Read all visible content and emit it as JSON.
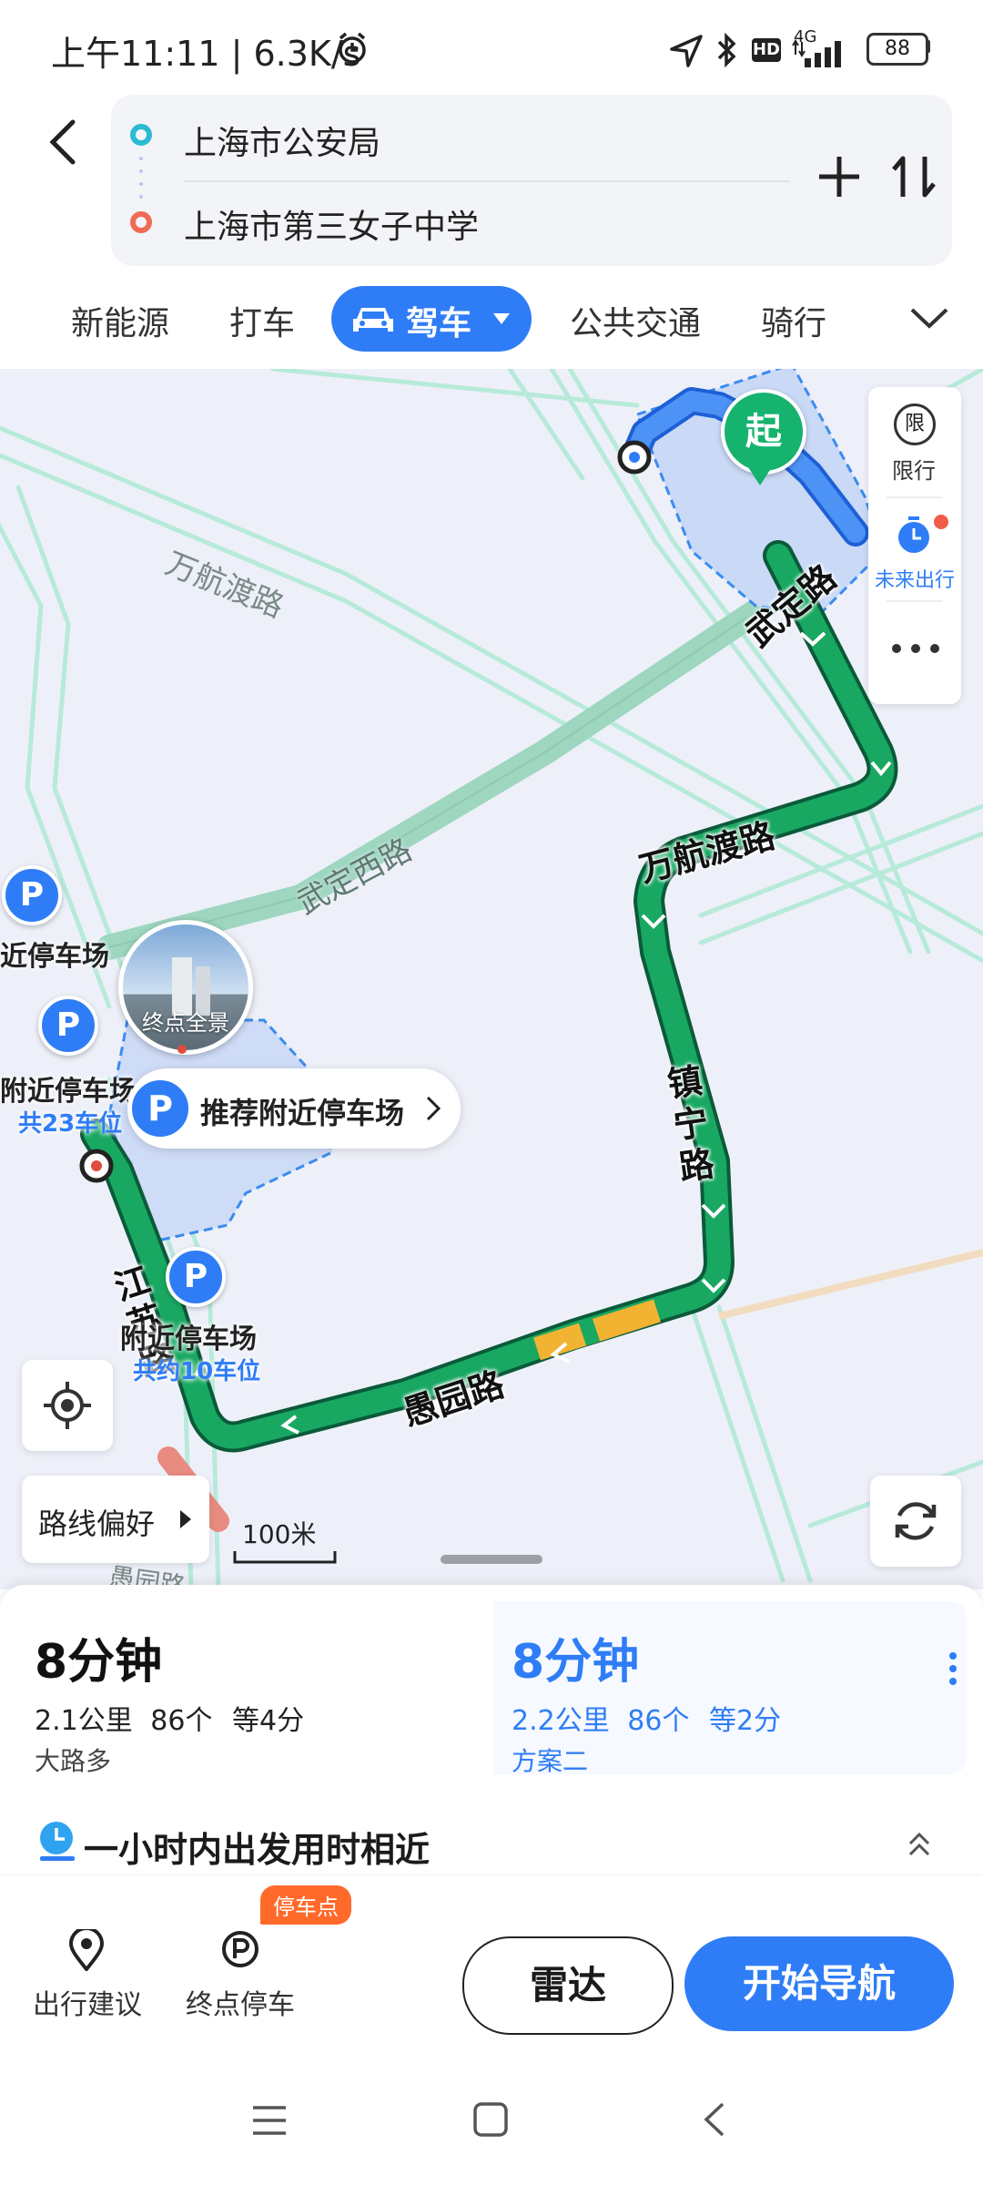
{
  "status_bar": {
    "left_text": "上午11:11 | 6.3K/s",
    "network": "4G",
    "hd": "HD",
    "battery": "88"
  },
  "route": {
    "origin": "上海市公安局",
    "destination": "上海市第三女子中学"
  },
  "modes": {
    "new_energy": "新能源",
    "taxi": "打车",
    "drive": "驾车",
    "transit": "公共交通",
    "bike": "骑行"
  },
  "map": {
    "start_marker": "起",
    "side_tools": {
      "restriction_icon": "限",
      "restriction": "限行",
      "future": "未来出行"
    },
    "roads": {
      "wanhang_gray": "万航渡路",
      "wuding_west": "武定西路",
      "wuding": "武定路",
      "wanhang": "万航渡路",
      "zhenning": "镇宁路",
      "yuyuan": "愚园路",
      "jiangsu": "江苏路",
      "yuyuan_bottom": "愚园路"
    },
    "parking": {
      "p_symbol": "P",
      "lot_1": "近停车场",
      "lot_2": "附近停车场",
      "lot_2_count": "共23车位",
      "lot_3": "附近停车场",
      "lot_3_count": "共约10车位"
    },
    "dest_panorama": "终点全景",
    "recommend_parking": "推荐附近停车场",
    "route_pref": "路线偏好",
    "scale": "100米"
  },
  "routes": [
    {
      "time": "8分钟",
      "distance": "2.1公里",
      "lights": "6个",
      "wait": "等4分",
      "tag": "大路多"
    },
    {
      "time": "8分钟",
      "distance": "2.2公里",
      "lights": "6个",
      "wait": "等2分",
      "tag": "方案二"
    }
  ],
  "hint": "一小时内出发用时相近",
  "actions": {
    "suggest": "出行建议",
    "dest_parking": "终点停车",
    "parking_badge": "停车点",
    "radar": "雷达",
    "navigate": "开始导航"
  },
  "colors": {
    "accent": "#2f7df6",
    "route_green": "#18a862",
    "route_yellow": "#f3b332",
    "road": "#aee6d3"
  }
}
